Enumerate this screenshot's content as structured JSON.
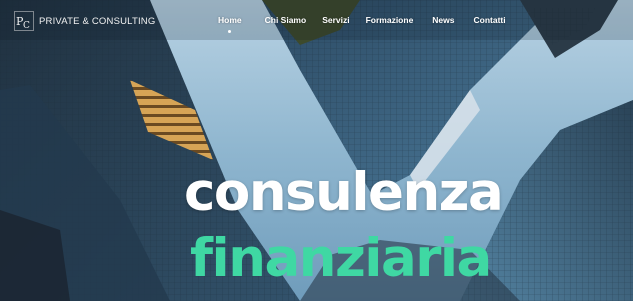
{
  "brand": {
    "logo_text": "P&C",
    "name": "PRIVATE & CONSULTING",
    "icon": "pc-monogram-logo"
  },
  "nav": {
    "items": [
      {
        "label": "Home",
        "active": true
      },
      {
        "label": "Chi Siamo",
        "active": false
      },
      {
        "label": "Servizi",
        "active": false
      },
      {
        "label": "Formazione",
        "active": false
      },
      {
        "label": "News",
        "active": false
      },
      {
        "label": "Contatti",
        "active": false
      }
    ]
  },
  "hero": {
    "title_line1": "consulenza",
    "title_line2": "finanziaria",
    "background": "skyscrapers-looking-up-photo"
  },
  "colors": {
    "title_primary": "#ffffff",
    "title_accent": "#3fd8a3",
    "sky": "#8fb6cf",
    "tower_dark": "#1c2a38",
    "tower_glass": "#3f6f8f",
    "tower_warm": "#c8954b"
  }
}
